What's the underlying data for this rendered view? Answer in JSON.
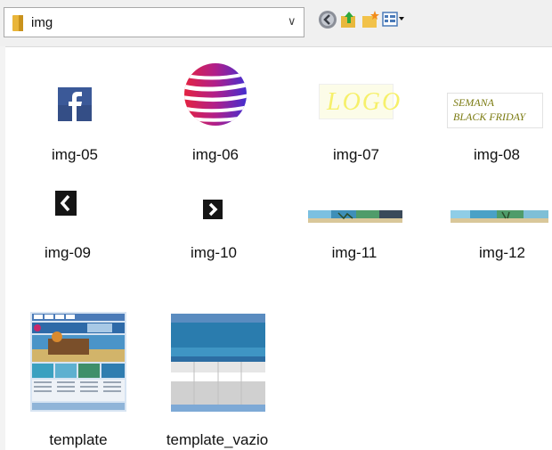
{
  "window": {
    "title": "img"
  },
  "address": {
    "path": "img",
    "dropdown_glyph": "∨"
  },
  "toolbar_icons": [
    "back-icon",
    "up-folder-icon",
    "new-folder-icon",
    "view-menu-icon"
  ],
  "items": [
    {
      "name": "img-05",
      "thumb": "facebook-icon"
    },
    {
      "name": "img-06",
      "thumb": "striped-sphere-logo"
    },
    {
      "name": "img-07",
      "thumb": "logo-text",
      "text": "LOGO"
    },
    {
      "name": "img-08",
      "thumb": "black-friday-banner",
      "text_line1": "SEMANA",
      "text_line2": "BLACK FRIDAY"
    },
    {
      "name": "img-09",
      "thumb": "chevron-left-icon"
    },
    {
      "name": "img-10",
      "thumb": "chevron-right-icon"
    },
    {
      "name": "img-11",
      "thumb": "beach-banner"
    },
    {
      "name": "img-12",
      "thumb": "beach-banner"
    },
    {
      "name": "template",
      "thumb": "template-page-preview"
    },
    {
      "name": "template_vazio",
      "thumb": "empty-template-preview"
    }
  ],
  "colors": {
    "facebook_blue": "#3b5998",
    "sphere_red": "#e8233a",
    "sphere_blue": "#3a2fd6",
    "logo_yellow": "#f6f06a",
    "banner_olive": "#7a7a10",
    "ocean": "#2a8fc0"
  }
}
